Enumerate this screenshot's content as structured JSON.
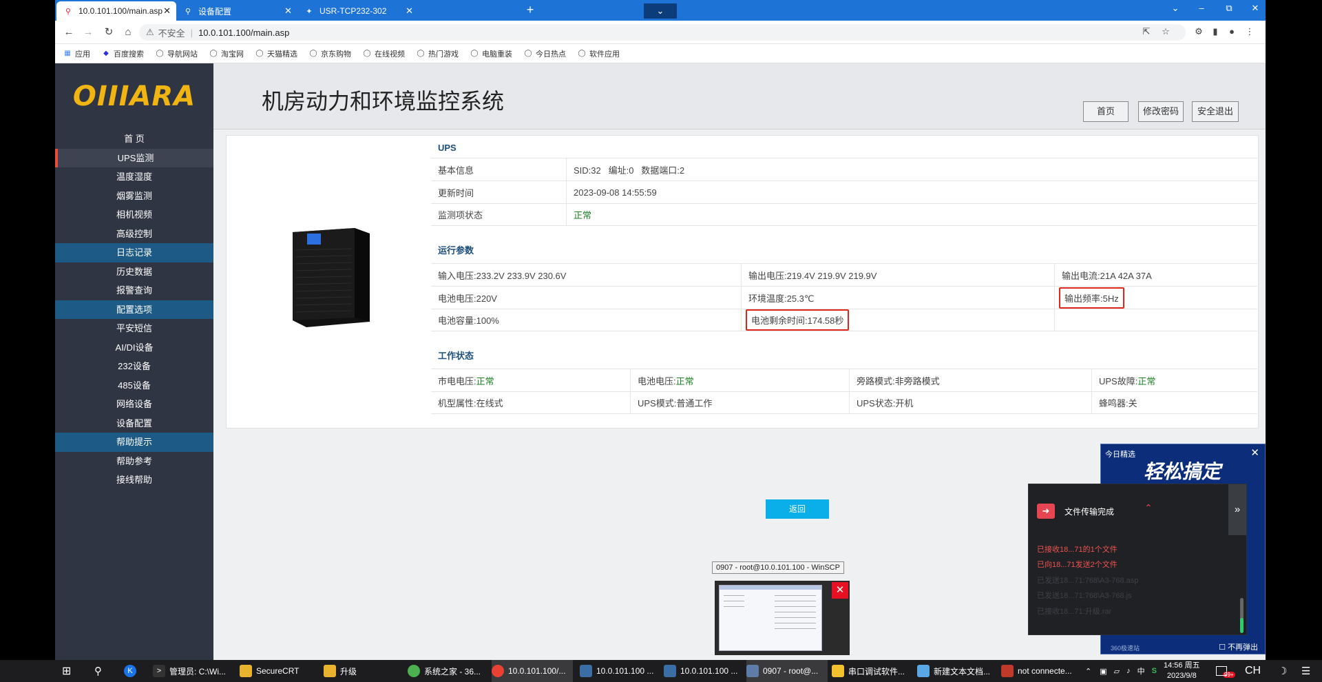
{
  "browser": {
    "tabs": [
      {
        "title": "10.0.101.100/main.asp",
        "icon": "search-favicon"
      },
      {
        "title": "设备配置",
        "icon": "search-favicon"
      },
      {
        "title": "USR-TCP232-302",
        "icon": "usr-favicon"
      }
    ],
    "address": {
      "insecure": "不安全",
      "url": "10.0.101.100/main.asp"
    },
    "bookmarks": [
      "应用",
      "百度搜索",
      "导航网站",
      "淘宝网",
      "天猫精选",
      "京东购物",
      "在线视频",
      "热门游戏",
      "电脑重装",
      "今日热点",
      "软件应用"
    ]
  },
  "header": {
    "logo": "OIIIARA",
    "title": "机房动力和环境监控系统",
    "buttons": [
      "首页",
      "修改密码",
      "安全退出"
    ]
  },
  "sidebar": {
    "items": [
      {
        "label": "首 页",
        "kind": "home"
      },
      {
        "label": "UPS监测",
        "kind": "selected"
      },
      {
        "label": "温度湿度",
        "kind": "item"
      },
      {
        "label": "烟雾监测",
        "kind": "item"
      },
      {
        "label": "相机视频",
        "kind": "item"
      },
      {
        "label": "高级控制",
        "kind": "item"
      },
      {
        "label": "日志记录",
        "kind": "section"
      },
      {
        "label": "历史数据",
        "kind": "item"
      },
      {
        "label": "报警查询",
        "kind": "item"
      },
      {
        "label": "配置选项",
        "kind": "section"
      },
      {
        "label": "平安短信",
        "kind": "item"
      },
      {
        "label": "AI/DI设备",
        "kind": "item"
      },
      {
        "label": "232设备",
        "kind": "item"
      },
      {
        "label": "485设备",
        "kind": "item"
      },
      {
        "label": "网络设备",
        "kind": "item"
      },
      {
        "label": "设备配置",
        "kind": "item"
      },
      {
        "label": "帮助提示",
        "kind": "section"
      },
      {
        "label": "帮助参考",
        "kind": "item"
      },
      {
        "label": "接线帮助",
        "kind": "item"
      }
    ]
  },
  "ups": {
    "title": "UPS",
    "basic": {
      "label_info": "基本信息",
      "info": "SID:32   编址:0   数据端口:2",
      "label_time": "更新时间",
      "time": "2023-09-08 14:55:59",
      "label_status": "监测项状态",
      "status": "正常"
    },
    "run_title": "运行参数",
    "run": {
      "input_voltage": "输入电压:233.2V 233.9V 230.6V",
      "output_voltage": "输出电压:219.4V 219.9V 219.9V",
      "output_current": "输出电流:21A 42A 37A",
      "battery_voltage": "电池电压:220V",
      "env_temp": "环境温度:25.3℃",
      "output_freq": "输出频率:5Hz",
      "battery_capacity": "电池容量:100%",
      "battery_remaining": "电池剩余时间:174.58秒"
    },
    "work_title": "工作状态",
    "work": {
      "mains_label": "市电电压:",
      "mains": "正常",
      "battery_label": "电池电压:",
      "battery": "正常",
      "bypass": "旁路模式:非旁路模式",
      "fault_label": "UPS故障:",
      "fault": "正常",
      "model": "机型属性:在线式",
      "mode": "UPS模式:普通工作",
      "state": "UPS状态:开机",
      "buzzer": "蜂鸣器:关"
    },
    "back": "返回"
  },
  "promo": {
    "title": "今日精选",
    "headline": "轻松搞定",
    "footer": "360极速站",
    "no_more": "不再弹出"
  },
  "transfer": {
    "title": "文件传输完成",
    "lines": [
      "已接收18...71的1个文件",
      "已向18...71发送2个文件",
      "已发送18...71:768\\A3-768.asp",
      "已发送18...71:768\\A3-768.js",
      "已接收18...71:升级.rar"
    ]
  },
  "thumbnail": {
    "tooltip": "0907 - root@10.0.101.100 - WinSCP"
  },
  "taskbar": {
    "items": [
      "管理员: C:\\Wi...",
      "SecureCRT",
      "升级",
      "系统之家 - 36...",
      "10.0.101.100/...",
      "10.0.101.100 ...",
      "10.0.101.100 ...",
      "0907 - root@...",
      "串口调试软件...",
      "新建文本文档...",
      "not connecte..."
    ],
    "lang": "CH",
    "time": "14:56 周五",
    "date": "2023/9/8",
    "badge": "99+"
  }
}
